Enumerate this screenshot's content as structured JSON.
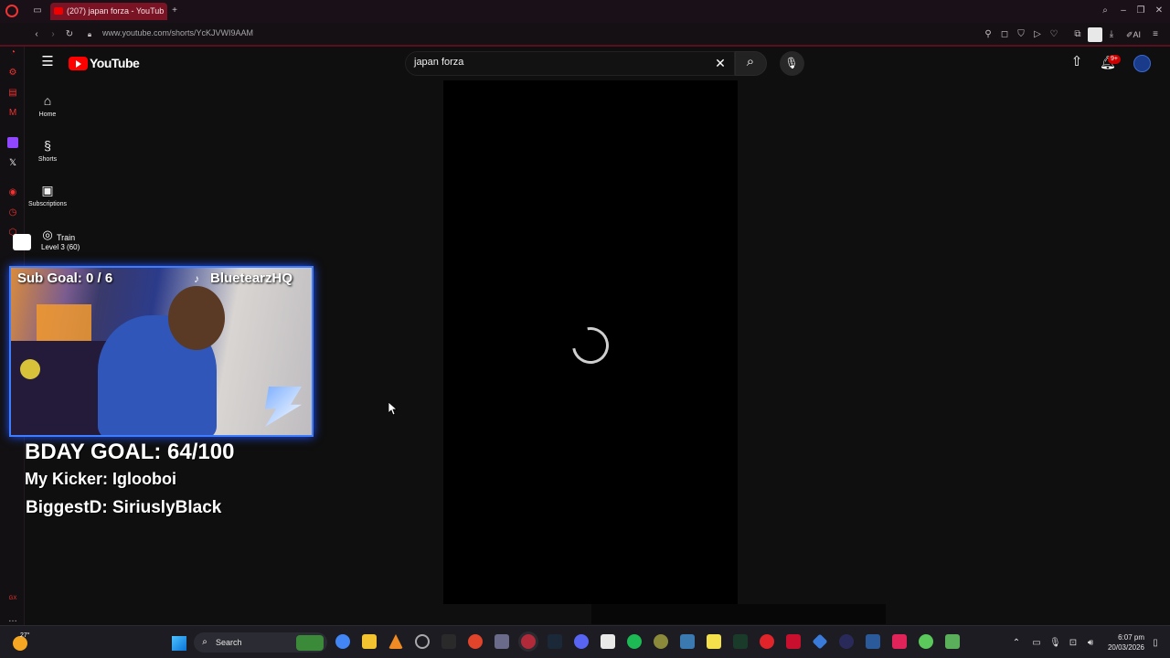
{
  "browser": {
    "tab_title": "(207) japan forza - YouTub",
    "url": "www.youtube.com/shorts/YcKJVWI9AAM",
    "new_tab_symbol": "+",
    "sidebar_gx_label": "GX"
  },
  "youtube": {
    "logo_text": "YouTube",
    "search": {
      "value": "japan forza"
    },
    "notification_count": "9+",
    "nav": [
      {
        "label": "Home",
        "icon": "home-icon"
      },
      {
        "label": "Shorts",
        "icon": "shorts-icon"
      },
      {
        "label": "Subscriptions",
        "icon": "subscriptions-icon"
      }
    ]
  },
  "overlay": {
    "train_label": "Train",
    "train_level": "Level 3  (60)",
    "sub_goal": "Sub Goal:  0 / 6",
    "streamer": "BluetearzHQ",
    "bday_goal": "BDAY GOAL: 64/100",
    "kicker": "My Kicker: Iglooboi",
    "biggest": "BiggestD: SiriuslyBlack"
  },
  "taskbar": {
    "weather": "27°",
    "search_label": "Search",
    "time": "6:07 pm",
    "date": "20/03/2026"
  },
  "colors": {
    "accent": "#ff0000",
    "opera_red": "#7a1424",
    "cam_border": "#3f7dff"
  }
}
